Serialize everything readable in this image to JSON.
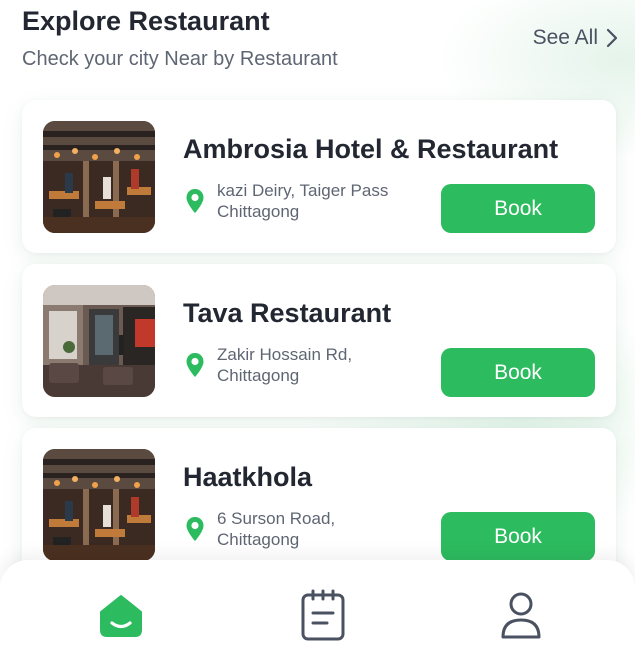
{
  "header": {
    "title": "Explore Restaurant",
    "subtitle": "Check your city Near by Restaurant",
    "see_all": "See All"
  },
  "restaurants": [
    {
      "name": "Ambrosia Hotel & Restaurant",
      "address_line1": "kazi Deiry, Taiger Pass",
      "address_line2": "Chittagong",
      "button": "Book"
    },
    {
      "name": "Tava Restaurant",
      "address_line1": "Zakir Hossain Rd,",
      "address_line2": "Chittagong",
      "button": "Book"
    },
    {
      "name": "Haatkhola",
      "address_line1": "6 Surson Road,",
      "address_line2": "Chittagong",
      "button": "Book"
    }
  ],
  "tabbar": {
    "items": [
      {
        "icon": "home-icon",
        "active": true
      },
      {
        "icon": "orders-icon",
        "active": false
      },
      {
        "icon": "profile-icon",
        "active": false
      }
    ]
  },
  "colors": {
    "accent": "#2dbb5f",
    "title": "#222731",
    "muted": "#5f6673",
    "icon_inactive": "#4a5160"
  }
}
